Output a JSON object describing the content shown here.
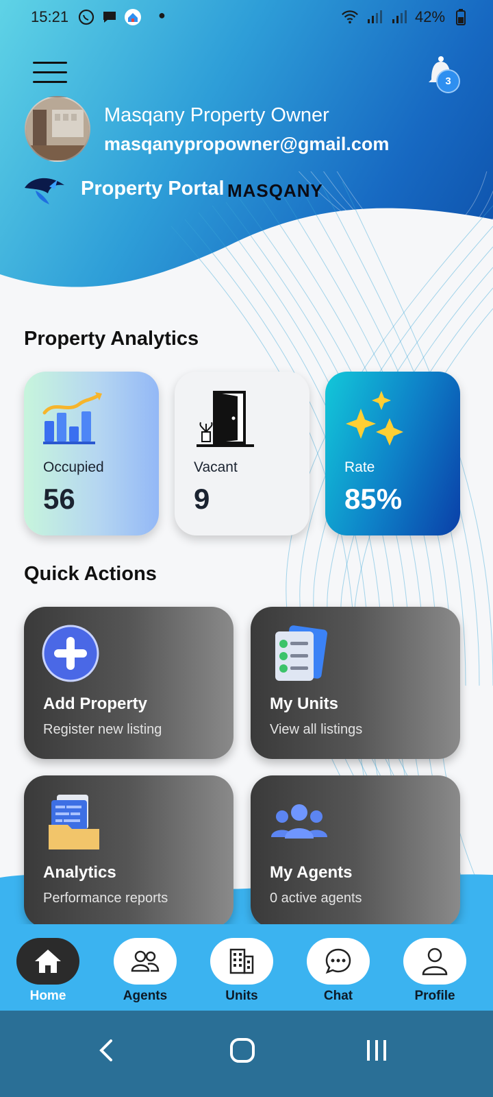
{
  "status_bar": {
    "time": "15:21",
    "battery": "42%"
  },
  "header": {
    "owner_name": "Masqany Property Owner",
    "owner_email": "masqanypropowner@gmail.com",
    "portal_title": "Property Portal",
    "brand": "MASQANY",
    "notification_count": "3"
  },
  "analytics": {
    "title": "Property Analytics",
    "occupied": {
      "label": "Occupied",
      "value": "56"
    },
    "vacant": {
      "label": "Vacant",
      "value": "9"
    },
    "rate": {
      "label": "Rate",
      "value": "85%"
    }
  },
  "quick_actions": {
    "title": "Quick Actions",
    "items": [
      {
        "title": "Add Property",
        "subtitle": "Register new listing"
      },
      {
        "title": "My Units",
        "subtitle": "View all listings"
      },
      {
        "title": "Analytics",
        "subtitle": "Performance reports"
      },
      {
        "title": "My Agents",
        "subtitle": "0 active agents"
      }
    ]
  },
  "bottom_nav": {
    "items": [
      {
        "label": "Home",
        "icon": "home-icon",
        "active": true
      },
      {
        "label": "Agents",
        "icon": "people-icon"
      },
      {
        "label": "Units",
        "icon": "building-icon"
      },
      {
        "label": "Chat",
        "icon": "chat-icon"
      },
      {
        "label": "Profile",
        "icon": "person-icon"
      }
    ]
  },
  "colors": {
    "header_start": "#5fd3e6",
    "header_end": "#0d4fa8",
    "nav_bar": "#3bb3f0",
    "active_pill": "#2b2b2b",
    "system_nav": "#2a6f96"
  }
}
